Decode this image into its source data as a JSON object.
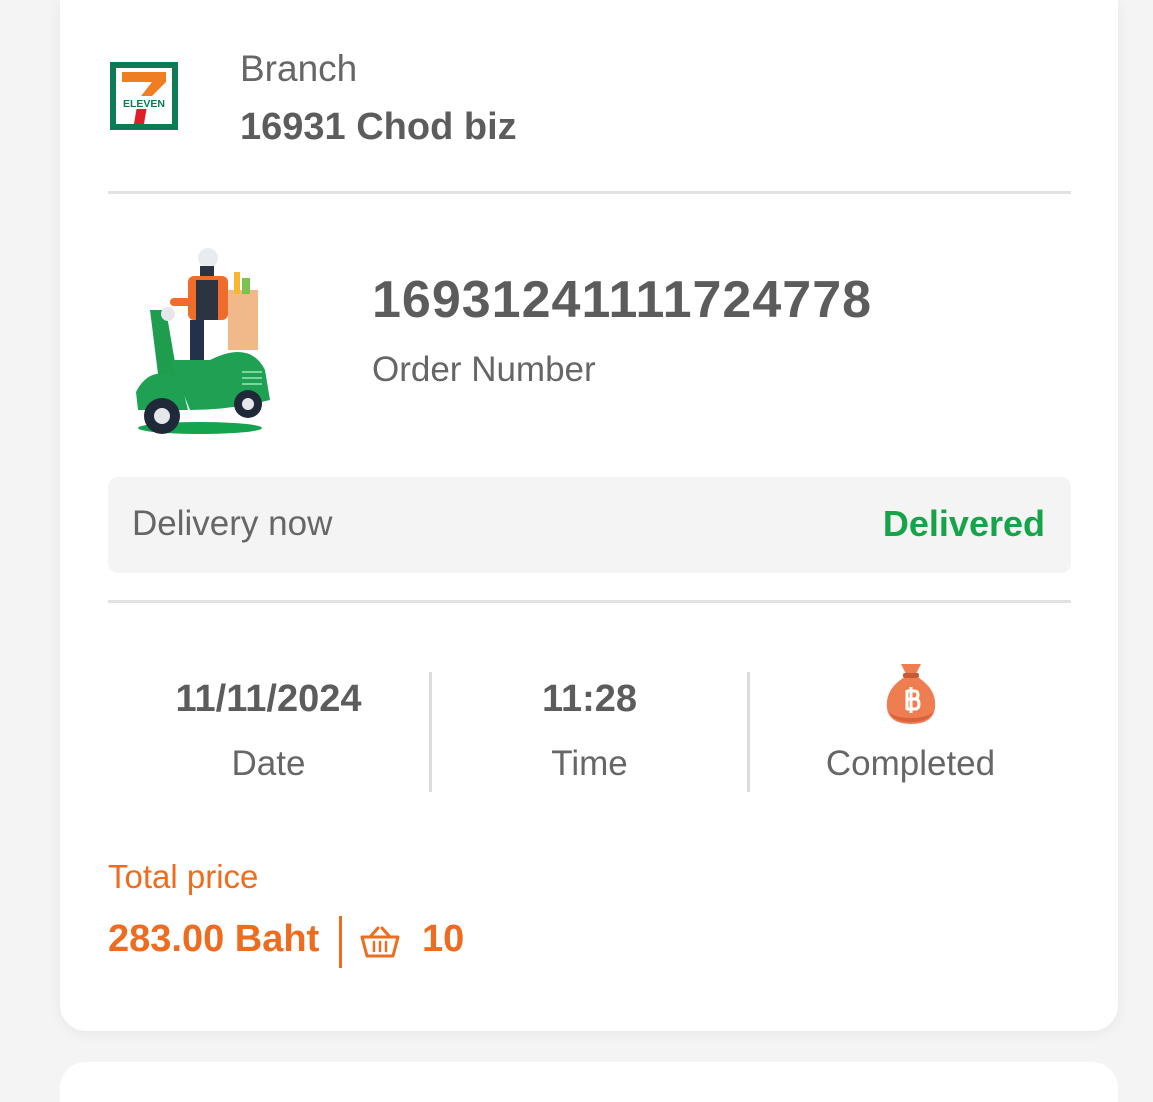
{
  "branch": {
    "label": "Branch",
    "name": "16931 Chod biz",
    "logo_text": "ELEVEN",
    "logo_icon": "seven-eleven-logo"
  },
  "order": {
    "number": "16931241111724778",
    "number_label": "Order Number",
    "illustration": "delivery-rider-scooter"
  },
  "delivery": {
    "type": "Delivery now",
    "status": "Delivered",
    "status_color": "#16a34a"
  },
  "stats": {
    "date": "11/11/2024",
    "date_label": "Date",
    "time": "11:28",
    "time_label": "Time",
    "payment_icon": "money-bag-baht-icon",
    "payment_label": "Completed"
  },
  "total": {
    "label": "Total price",
    "price": "283.00 Baht",
    "items": "10",
    "accent_color": "#ee6c1f"
  }
}
